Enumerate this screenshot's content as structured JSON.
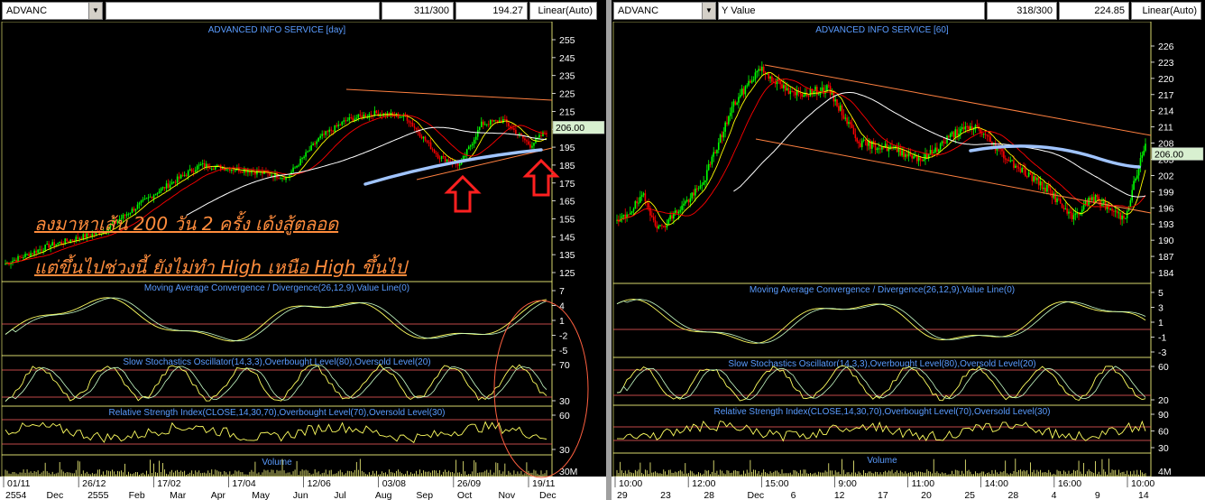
{
  "left": {
    "symbol": "ADVANC",
    "y_value_label": "",
    "count": "311/300",
    "value": "194.27",
    "scale": "Linear(Auto)",
    "price_title": "ADVANCED INFO SERVICE [day]",
    "price_ticks": [
      "255",
      "245",
      "235",
      "225",
      "215",
      "205",
      "195",
      "185",
      "175",
      "165",
      "155",
      "145",
      "135",
      "125"
    ],
    "current_price": "206.00",
    "annotation_line1": "ลงมาหาเส้น 200 วัน 2 ครั้ง เด้งสู้ตลอด",
    "annotation_line2": "แต่ขึ้นไปช่วงนี้ ยังไม่ทำ High เหนือ High ขึ้นไป",
    "macd_title": "Moving Average Convergence / Divergence(26,12,9),Value Line(0)",
    "macd_ticks": [
      "7",
      "4",
      "1",
      "-2",
      "-5"
    ],
    "stoch_title": "Slow Stochastics Oscillator(14,3,3),Overbought Level(80),Oversold Level(20)",
    "stoch_ticks": [
      "70",
      "30"
    ],
    "rsi_title": "Relative Strength Index(CLOSE,14,30,70),Overbought Level(70),Oversold Level(30)",
    "rsi_ticks": [
      "60",
      "30"
    ],
    "volume_title": "Volume",
    "volume_ticks": [
      "30M"
    ],
    "x_row1": [
      "01/11",
      "26/12",
      "17/02",
      "17/04",
      "12/06",
      "03/08",
      "26/09",
      "19/11"
    ],
    "x_row2": [
      "2554",
      "Dec",
      "2555",
      "Feb",
      "Mar",
      "Apr",
      "May",
      "Jun",
      "Jul",
      "Aug",
      "Sep",
      "Oct",
      "Nov",
      "Dec"
    ]
  },
  "right": {
    "symbol": "ADVANC",
    "y_value_label": "Y Value",
    "count": "318/300",
    "value": "224.85",
    "scale": "Linear(Auto)",
    "price_title": "ADVANCED INFO SERVICE [60]",
    "price_ticks": [
      "226",
      "223",
      "220",
      "217",
      "214",
      "211",
      "208",
      "205",
      "202",
      "199",
      "196",
      "193",
      "190",
      "187",
      "184"
    ],
    "current_price": "206.00",
    "macd_title": "Moving Average Convergence / Divergence(26,12,9),Value Line(0)",
    "macd_ticks": [
      "5",
      "3",
      "1",
      "-1",
      "-3"
    ],
    "stoch_title": "Slow Stochastics Oscillator(14,3,3),Overbought Level(80),Oversold Level(20)",
    "stoch_ticks": [
      "60",
      "20"
    ],
    "rsi_title": "Relative Strength Index(CLOSE,14,30,70),Overbought Level(70),Oversold Level(30)",
    "rsi_ticks": [
      "90",
      "60",
      "30"
    ],
    "volume_title": "Volume",
    "volume_ticks": [
      "4M"
    ],
    "x_row1": [
      "10:00",
      "12:00",
      "15:00",
      "9:00",
      "11:00",
      "14:00",
      "16:00",
      "10:00"
    ],
    "x_row2": [
      "29",
      "23",
      "28",
      "Dec",
      "6",
      "12",
      "17",
      "20",
      "25",
      "28",
      "4",
      "9",
      "14"
    ]
  },
  "colors": {
    "background": "#000000",
    "candle_up": "#00ff00",
    "candle_down": "#ff0000",
    "ma_short": "#ff0000",
    "ma_mid": "#ffff00",
    "ma_long": "#ffffff",
    "trendline": "#ff8040",
    "curve": "#a0c4ff",
    "title_blue": "#5a9cff",
    "annotation": "#ff8c3c"
  }
}
